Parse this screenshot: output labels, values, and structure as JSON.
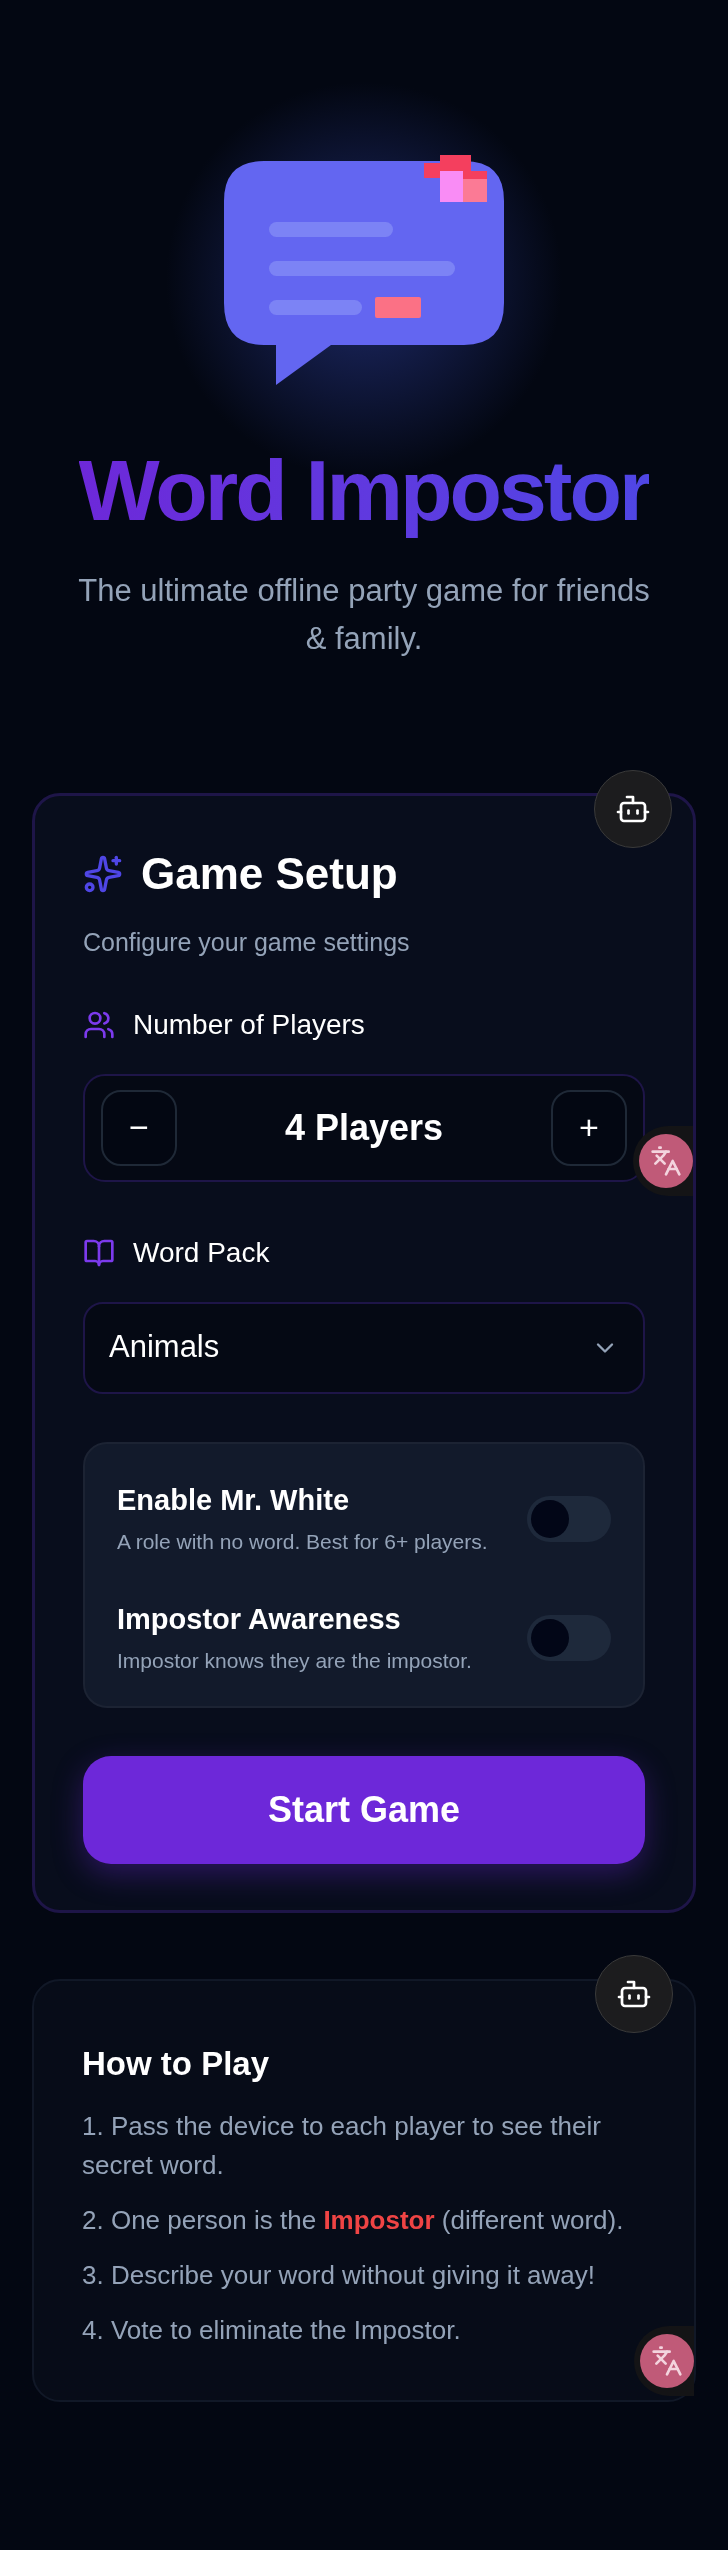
{
  "hero": {
    "title": "Word Impostor",
    "subtitle": "The ultimate offline party game for friends & family."
  },
  "setup": {
    "title": "Game Setup",
    "subtitle": "Configure your game settings",
    "players_label": "Number of Players",
    "players_value": "4 Players",
    "minus": "−",
    "plus": "+",
    "word_pack_label": "Word Pack",
    "word_pack_value": "Animals",
    "toggles": [
      {
        "title": "Enable Mr. White",
        "description": "A role with no word. Best for 6+ players.",
        "on": false
      },
      {
        "title": "Impostor Awareness",
        "description": "Impostor knows they are the impostor.",
        "on": false
      }
    ],
    "start_button": "Start Game"
  },
  "how_to_play": {
    "title": "How to Play",
    "steps": [
      "1. Pass the device to each player to see their secret word.",
      "2. One person is the **Impostor** (different word).",
      "3. Describe your word without giving it away!",
      "4. Vote to eliminate the Impostor."
    ]
  }
}
